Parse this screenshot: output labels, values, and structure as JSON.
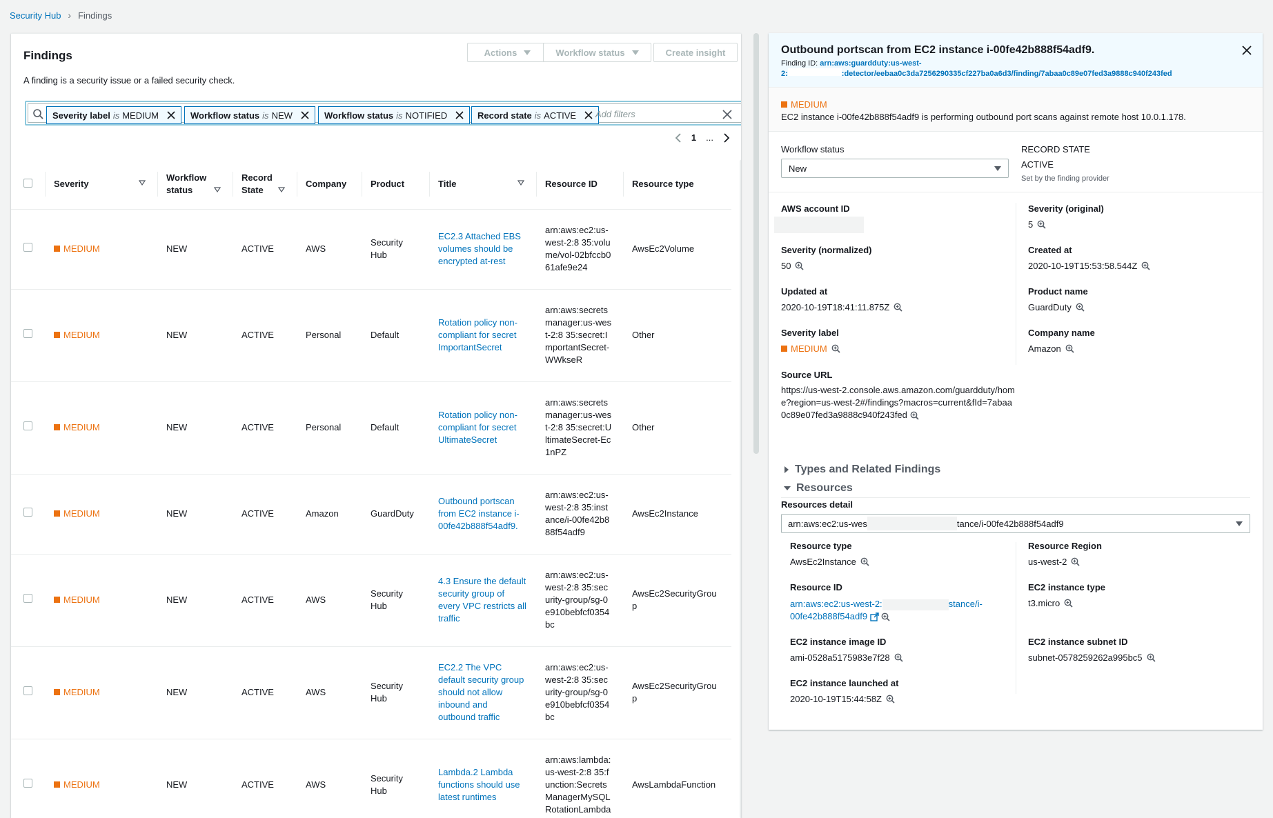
{
  "breadcrumb": {
    "root": "Security Hub",
    "current": "Findings"
  },
  "findings": {
    "title": "Findings",
    "description": "A finding is a security issue or a failed security check.",
    "buttons": {
      "actions": "Actions",
      "workflow": "Workflow status",
      "create_insight": "Create insight"
    },
    "filters": [
      {
        "key": "Severity label",
        "op": "is",
        "value": "MEDIUM"
      },
      {
        "key": "Workflow status",
        "op": "is",
        "value": "NEW"
      },
      {
        "key": "Workflow status",
        "op": "is",
        "value": "NOTIFIED"
      },
      {
        "key": "Record state",
        "op": "is",
        "value": "ACTIVE"
      }
    ],
    "add_filters_placeholder": "Add filters",
    "pager": {
      "page": "1",
      "ellipsis": "..."
    },
    "columns": {
      "severity": "Severity",
      "workflow": "Workflow status",
      "record": "Record State",
      "company": "Company",
      "product": "Product",
      "title": "Title",
      "resource_id": "Resource ID",
      "resource_type": "Resource type"
    },
    "rows": [
      {
        "severity": "MEDIUM",
        "workflow": "NEW",
        "record": "ACTIVE",
        "company": "AWS",
        "product": "Security Hub",
        "title": "EC2.3 Attached EBS volumes should be encrypted at-rest",
        "resource_id": "arn:aws:ec2:us-west-2:8 35:volume/vol-02bfccb061afe9e24",
        "resource_type": "AwsEc2Volume"
      },
      {
        "severity": "MEDIUM",
        "workflow": "NEW",
        "record": "ACTIVE",
        "company": "Personal",
        "product": "Default",
        "title": "Rotation policy non-compliant for secret ImportantSecret",
        "resource_id": "arn:aws:secretsmanager:us-west-2:8 35:secret:ImportantSecret-WWkseR",
        "resource_type": "Other"
      },
      {
        "severity": "MEDIUM",
        "workflow": "NEW",
        "record": "ACTIVE",
        "company": "Personal",
        "product": "Default",
        "title": "Rotation policy non-compliant for secret UltimateSecret",
        "resource_id": "arn:aws:secretsmanager:us-west-2:8 35:secret:UltimateSecret-Ec1nPZ",
        "resource_type": "Other"
      },
      {
        "severity": "MEDIUM",
        "workflow": "NEW",
        "record": "ACTIVE",
        "company": "Amazon",
        "product": "GuardDuty",
        "title": "Outbound portscan from EC2 instance i-00fe42b888f54adf9.",
        "resource_id": "arn:aws:ec2:us-west-2:8 35:instance/i-00fe42b888f54adf9",
        "resource_type": "AwsEc2Instance"
      },
      {
        "severity": "MEDIUM",
        "workflow": "NEW",
        "record": "ACTIVE",
        "company": "AWS",
        "product": "Security Hub",
        "title": "4.3 Ensure the default security group of every VPC restricts all traffic",
        "resource_id": "arn:aws:ec2:us-west-2:8 35:security-group/sg-0e910bebfcf0354bc",
        "resource_type": "AwsEc2SecurityGroup"
      },
      {
        "severity": "MEDIUM",
        "workflow": "NEW",
        "record": "ACTIVE",
        "company": "AWS",
        "product": "Security Hub",
        "title": "EC2.2 The VPC default security group should not allow inbound and outbound traffic",
        "resource_id": "arn:aws:ec2:us-west-2:8 35:security-group/sg-0e910bebfcf0354bc",
        "resource_type": "AwsEc2SecurityGroup"
      },
      {
        "severity": "MEDIUM",
        "workflow": "NEW",
        "record": "ACTIVE",
        "company": "AWS",
        "product": "Security Hub",
        "title": "Lambda.2 Lambda functions should use latest runtimes",
        "resource_id": "arn:aws:lambda:us-west-2:8 35:function:SecretsManagerMySQLRotationLambda",
        "resource_type": "AwsLambdaFunction"
      }
    ]
  },
  "detail": {
    "title": "Outbound portscan from EC2 instance i-00fe42b888f54adf9.",
    "finding_id_label": "Finding ID:",
    "finding_id_part1": "arn:aws:guardduty:us-west-",
    "finding_id_part2": "2:",
    "finding_id_part3": ":detector/eebaa0c3da7256290335cf227ba0a6d3/finding/7abaa0c89e07fed3a9888c940f243fed",
    "severity": "MEDIUM",
    "summary": "EC2 instance i-00fe42b888f54adf9 is performing outbound port scans against remote host 10.0.1.178.",
    "workflow_label": "Workflow status",
    "workflow_value": "New",
    "record_state_label": "RECORD STATE",
    "record_state_value": "ACTIVE",
    "record_state_note": "Set by the finding provider",
    "aws_account_label": "AWS account ID",
    "severity_original_label": "Severity (original)",
    "severity_original_value": "5",
    "severity_normalized_label": "Severity (normalized)",
    "severity_normalized_value": "50",
    "created_label": "Created at",
    "created_value": "2020-10-19T15:53:58.544Z",
    "updated_label": "Updated at",
    "updated_value": "2020-10-19T18:41:11.875Z",
    "product_label": "Product name",
    "product_value": "GuardDuty",
    "severity_label_label": "Severity label",
    "severity_label_value": "MEDIUM",
    "company_label": "Company name",
    "company_value": "Amazon",
    "source_url_label": "Source URL",
    "source_url_value": "https://us-west-2.console.aws.amazon.com/guardduty/home?region=us-west-2#/findings?macros=current&fId=7abaa0c89e07fed3a9888c940f243fed",
    "types_label": "Types and Related Findings",
    "resources_label": "Resources",
    "resources_detail_label": "Resources detail",
    "resources_select_part1": "arn:aws:ec2:us-wes",
    "resources_select_part2": "tance/i-00fe42b888f54adf9",
    "resource_type_label": "Resource type",
    "resource_type_value": "AwsEc2Instance",
    "resource_region_label": "Resource Region",
    "resource_region_value": "us-west-2",
    "resource_id_label": "Resource ID",
    "resource_id_part1": "arn:aws:ec2:us-west-2:",
    "resource_id_part2": "stance/i-",
    "resource_id_part3": "00fe42b888f54adf9",
    "instance_type_label": "EC2 instance type",
    "instance_type_value": "t3.micro",
    "image_id_label": "EC2 instance image ID",
    "image_id_value": "ami-0528a5175983e7f28",
    "subnet_label": "EC2 instance subnet ID",
    "subnet_value": "subnet-0578259262a995bc5",
    "launched_label": "EC2 instance launched at",
    "launched_value": "2020-10-19T15:44:58Z"
  },
  "colors": {
    "link": "#0073bb",
    "medium": "#ec7211",
    "token_border": "#0073bb"
  }
}
